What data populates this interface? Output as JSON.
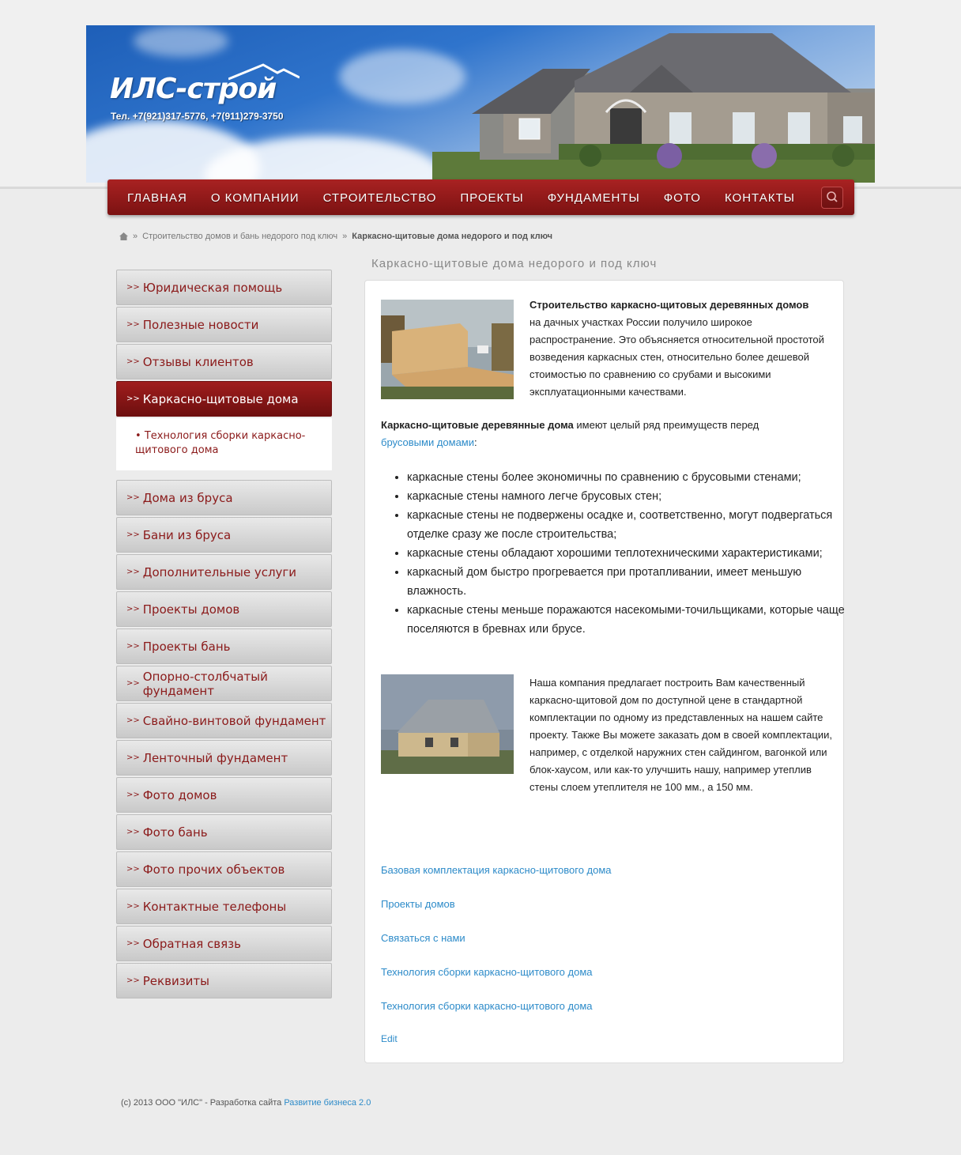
{
  "brand": {
    "logo_text": "ИЛС-строй",
    "phone": "Тел. +7(921)317-5776, +7(911)279-3750"
  },
  "nav": {
    "items": [
      "ГЛАВНАЯ",
      "О КОМПАНИИ",
      "СТРОИТЕЛЬСТВО",
      "ПРОЕКТЫ",
      "ФУНДАМЕНТЫ",
      "ФОТО",
      "КОНТАКТЫ"
    ],
    "search_icon": "search-icon"
  },
  "breadcrumb": {
    "home_icon": "home-icon",
    "sep": "»",
    "parent": "Строительство домов и бань недорого под ключ",
    "current": "Каркасно-щитовые дома недорого и под ключ"
  },
  "sidebar": {
    "items": [
      "Юридическая помощь",
      "Полезные новости",
      "Отзывы клиентов",
      "Каркасно-щитовые дома",
      "Дома из бруса",
      "Бани из бруса",
      "Дополнительные услуги",
      "Проекты домов",
      "Проекты бань",
      "Опорно-столбчатый фундамент",
      "Свайно-винтовой фундамент",
      "Ленточный фундамент",
      "Фото домов",
      "Фото бань",
      "Фото прочих объектов",
      "Контактные телефоны",
      "Обратная связь",
      "Реквизиты"
    ],
    "active_index": 3,
    "sub_item": "Технология сборки каркасно-щитового дома",
    "chevron": ">>"
  },
  "content": {
    "title": "Каркасно-щитовые дома недорого и под ключ",
    "p1_bold": "Строительство каркасно-щитовых деревянных домов",
    "p1_text": "на дачных участках России получило широкое распространение. Это объясняется относительной простотой возведения каркасных стен, относительно более дешевой стоимостью по сравнению со срубами и высокими эксплуатационными качествами.",
    "p2_bold": "Каркасно-щитовые деревянные дома",
    "p2_text": " имеют целый ряд преимуществ перед ",
    "p2_link": "брусовыми домами",
    "p2_end": ":",
    "list": [
      "каркасные стены более экономичны по сравнению с брусовыми стенами;",
      "каркасные стены намного легче брусовых стен;",
      "каркасные стены не подвержены осадке и, соответственно, могут подвергаться отделке сразу же после строительства;",
      "каркасные стены обладают хорошими теплотехническими характеристиками;",
      "каркасный дом быстро прогревается при протапливании, имеет меньшую влажность.",
      "каркасные стены меньше поражаются насекомыми-точильщиками, которые чаще поселяются в бревнах или брусе."
    ],
    "p3": "Наша компания  предлагает построить Вам качественный каркасно-щитовой дом по доступной цене в стандартной комплектации по одному из представленных на нашем сайте проекту. Также Вы можете  заказать дом в своей комплектации, например, с отделкой наружних стен сайдингом, вагонкой или блок-хаусом, или как-то улучшить нашу, например утеплив стены слоем утеплителя не 100 мм., а 150 мм.",
    "links": [
      "Базовая комплектация каркасно-щитового дома",
      "Проекты домов",
      "Связаться с нами",
      "Технология сборки каркасно-щитового дома",
      "Технология сборки каркасно-щитового дома"
    ],
    "edit": "Edit"
  },
  "footer": {
    "text": "(c) 2013 ООО \"ИЛС\" - Разработка сайта ",
    "link": "Развитие бизнеса 2.0"
  },
  "colors": {
    "accent": "#8b1a1a",
    "nav_top": "#a92222",
    "link": "#2d8bc9"
  }
}
